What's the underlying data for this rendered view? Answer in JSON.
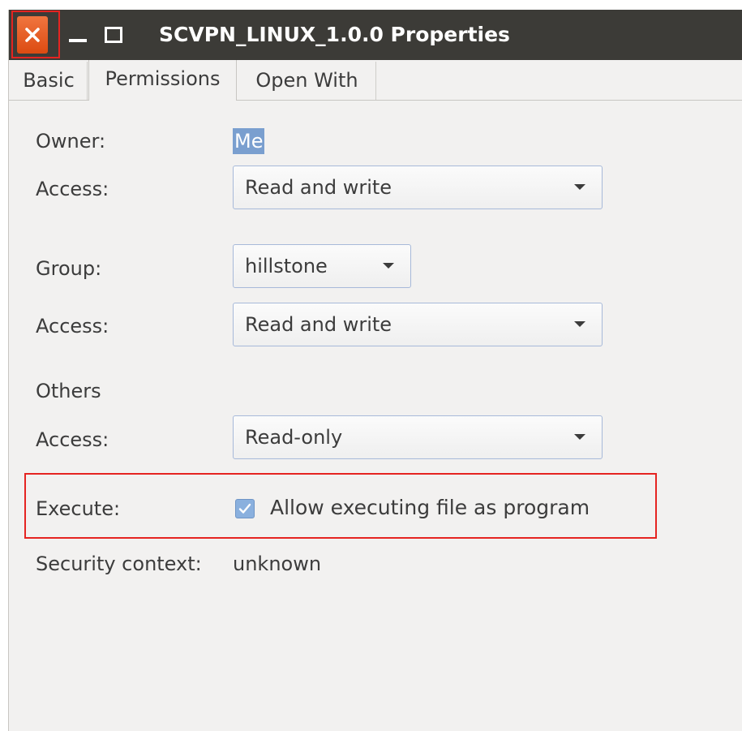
{
  "window": {
    "title": "SCVPN_LINUX_1.0.0 Properties",
    "controls": [
      "close-icon",
      "minimize-icon",
      "maximize-icon"
    ],
    "colors": {
      "titlebar": "#3c3b37",
      "close_button": "#e8602a",
      "highlight": "#e52421",
      "selection": "#7a9fcf"
    }
  },
  "tabs": [
    {
      "label": "Basic",
      "active": false
    },
    {
      "label": "Permissions",
      "active": true
    },
    {
      "label": "Open With",
      "active": false
    }
  ],
  "permissions": {
    "owner": {
      "label": "Owner:",
      "value": "Me"
    },
    "owner_access": {
      "label": "Access:",
      "value": "Read and write"
    },
    "group": {
      "label": "Group:",
      "value": "hillstone"
    },
    "group_access": {
      "label": "Access:",
      "value": "Read and write"
    },
    "others": {
      "heading": "Others"
    },
    "others_access": {
      "label": "Access:",
      "value": "Read-only"
    },
    "execute": {
      "label": "Execute:",
      "checkbox_label": "Allow executing file as program",
      "checked": true
    },
    "security_context": {
      "label": "Security context:",
      "value": "unknown"
    }
  }
}
